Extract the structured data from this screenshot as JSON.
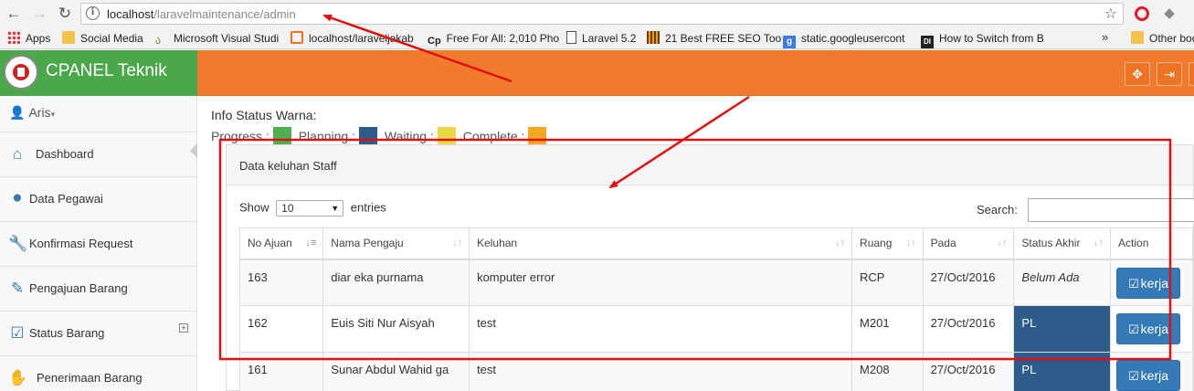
{
  "browser": {
    "url_host": "localhost",
    "url_path": "/laravelmaintenance/admin",
    "bookmarks": [
      {
        "label": "Apps",
        "icon": "apps-grid-icon"
      },
      {
        "label": "Social Media",
        "icon": "folder-icon"
      },
      {
        "label": "Microsoft Visual Studi",
        "icon": "vs-icon"
      },
      {
        "label": "localhost/laraveljakab",
        "icon": "xampp-icon"
      },
      {
        "label": "Free For All: 2,010 Pho",
        "icon": "cp-icon"
      },
      {
        "label": "Laravel 5.2",
        "icon": "document-icon"
      },
      {
        "label": "21 Best FREE SEO Too",
        "icon": "bars-icon"
      },
      {
        "label": "static.googleusercont",
        "icon": "google-icon"
      },
      {
        "label": "How to Switch from B",
        "icon": "di-icon"
      },
      {
        "label": "Other boo",
        "icon": "folder-icon"
      }
    ],
    "more": "»"
  },
  "app": {
    "brand": "CPANEL Teknik",
    "user": "Aris"
  },
  "sidebar": {
    "items": [
      {
        "label": "Dashboard",
        "icon": "home-icon"
      },
      {
        "label": "Data Pegawai",
        "icon": "user-icon"
      },
      {
        "label": "Konfirmasi Request",
        "icon": "wrench-icon"
      },
      {
        "label": "Pengajuan Barang",
        "icon": "pencil-icon"
      },
      {
        "label": "Status Barang",
        "icon": "check-square-icon"
      },
      {
        "label": "Penerimaan Barang",
        "icon": "hand-icon"
      }
    ]
  },
  "info": {
    "title": "Info Status Warna:",
    "legend": [
      {
        "label": "Progress :",
        "color": "#4caf50"
      },
      {
        "label": "Planning :",
        "color": "#2e5c8a"
      },
      {
        "label": "Waiting :",
        "color": "#e8d84a"
      },
      {
        "label": "Complete :",
        "color": "#f5a623"
      }
    ]
  },
  "panel": {
    "title": "Data keluhan Staff",
    "show": "Show",
    "entries_value": "10",
    "entries": "entries",
    "search": "Search:"
  },
  "table": {
    "columns": [
      "No Ajuan",
      "Nama Pengaju",
      "Keluhan",
      "Ruang",
      "Pada",
      "Status Akhir",
      "Action"
    ],
    "rows": [
      {
        "no": "163",
        "nama": "diar eka purnama",
        "keluhan": "komputer error",
        "ruang": "RCP",
        "pada": "27/Oct/2016",
        "status": "Belum Ada",
        "action": "kerja"
      },
      {
        "no": "162",
        "nama": "Euis Siti Nur Aisyah",
        "keluhan": "test",
        "ruang": "M201",
        "pada": "27/Oct/2016",
        "status": "PL",
        "action": "kerja"
      },
      {
        "no": "161",
        "nama": "Sunar Abdul Wahid ga",
        "keluhan": "test",
        "ruang": "M208",
        "pada": "27/Oct/2016",
        "status": "PL",
        "action": "kerja"
      }
    ]
  },
  "colors": {
    "brand_green": "#4aa84a",
    "topbar_orange": "#f07b2d",
    "annotation_red": "#e01010",
    "button_blue": "#337ab7",
    "planning_blue": "#2e5c8a"
  }
}
